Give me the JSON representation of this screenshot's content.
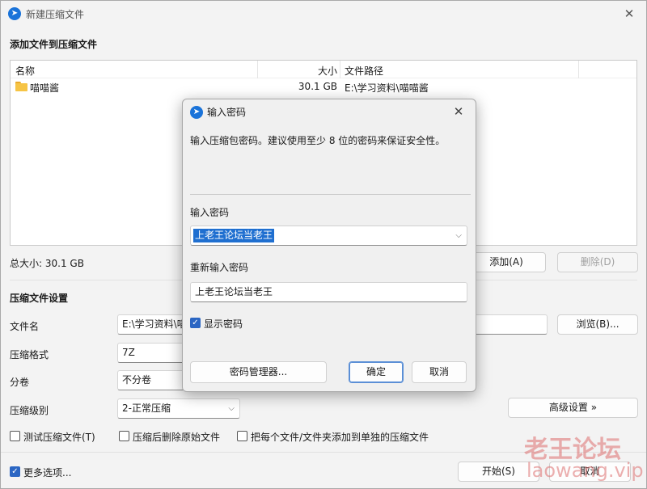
{
  "window": {
    "title": "新建压缩文件"
  },
  "add_section": {
    "title": "添加文件到压缩文件",
    "columns": [
      "名称",
      "大小",
      "文件路径"
    ],
    "rows": [
      {
        "name": "喵喵酱",
        "size": "30.1 GB",
        "path": "E:\\学习资料\\喵喵酱"
      }
    ],
    "total_size": "总大小: 30.1 GB",
    "add_button": "添加(A)",
    "delete_button": "删除(D)"
  },
  "settings": {
    "title": "压缩文件设置",
    "filename_label": "文件名",
    "filename_value": "E:\\学习资料\\喵",
    "browse_button": "浏览(B)...",
    "format_label": "压缩格式",
    "format_value": "7Z",
    "volume_label": "分卷",
    "volume_value": "不分卷",
    "level_label": "压缩级别",
    "level_value": "2-正常压缩",
    "advanced_button": "高级设置 »",
    "test_checkbox": "测试压缩文件(T)",
    "delete_after_checkbox": "压缩后删除原始文件",
    "separate_checkbox": "把每个文件/文件夹添加到单独的压缩文件"
  },
  "footer": {
    "more_options": "更多选项...",
    "start_button": "开始(S)",
    "cancel_button": "取消"
  },
  "dialog": {
    "title": "输入密码",
    "hint": "输入压缩包密码。建议使用至少 8 位的密码来保证安全性。",
    "password_label": "输入密码",
    "password_value": "上老王论坛当老王",
    "confirm_label": "重新输入密码",
    "confirm_value": "上老王论坛当老王",
    "show_password": "显示密码",
    "manager_button": "密码管理器...",
    "ok_button": "确定",
    "cancel_button": "取消"
  },
  "watermark": {
    "line1": "老王论坛",
    "line2": "laowang.vip"
  },
  "colors": {
    "accent": "#2b66c3",
    "selection": "#1f6fd0"
  }
}
